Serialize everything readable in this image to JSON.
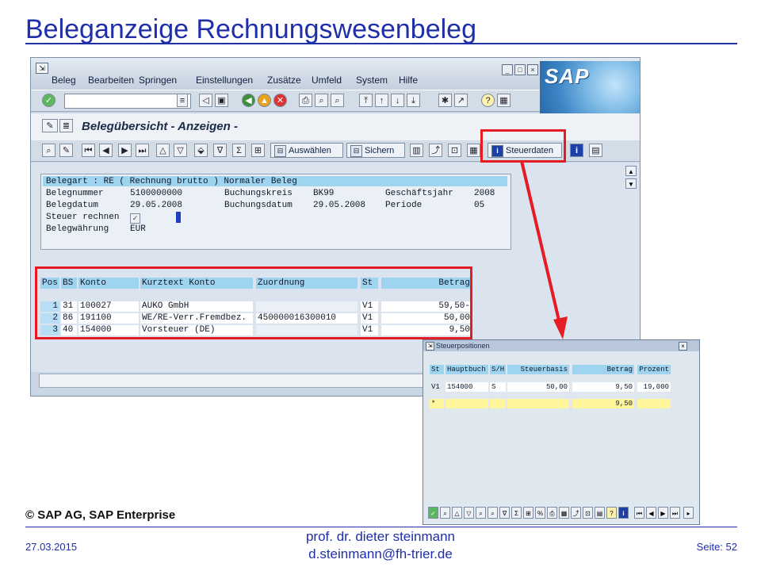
{
  "slide": {
    "title": "Beleganzeige Rechnungswesenbeleg",
    "copyright": "© SAP AG, SAP Enterprise",
    "footer": {
      "date": "27.03.2015",
      "author": "prof. dr. dieter steinmann",
      "email": "d.steinmann@fh-trier.de",
      "page": "Seite: 52"
    }
  },
  "sap": {
    "logo_text": "SAP",
    "menu": [
      "Beleg",
      "Bearbeiten",
      "Springen",
      "Einstellungen",
      "Zusätze",
      "Umfeld",
      "System",
      "Hilfe"
    ],
    "screen_title": "Belegübersicht - Anzeigen -",
    "buttons": {
      "auswaehlen": "Auswählen",
      "sichern": "Sichern",
      "steuerdaten": "Steuerdaten"
    },
    "header": {
      "belegart_line": "Belegart : RE ( Rechnung brutto ) Normaler Beleg",
      "belegnummer_label": "Belegnummer",
      "belegnummer": "5100000000",
      "buchungskreis_label": "Buchungskreis",
      "buchungskreis": "BK99",
      "geschaeftsjahr_label": "Geschäftsjahr",
      "geschaeftsjahr": "2008",
      "belegdatum_label": "Belegdatum",
      "belegdatum": "29.05.2008",
      "buchungsdatum_label": "Buchungsdatum",
      "buchungsdatum": "29.05.2008",
      "periode_label": "Periode",
      "periode": "05",
      "steuer_label": "Steuer rechnen",
      "waehrung_label": "Belegwährung",
      "waehrung": "EUR"
    },
    "positions": {
      "columns": [
        "Pos",
        "BS",
        "Konto",
        "Kurztext Konto",
        "Zuordnung",
        "St",
        "Betrag"
      ],
      "rows": [
        [
          "1",
          "31",
          "100027",
          "AUKO GmbH",
          "",
          "V1",
          "59,50-"
        ],
        [
          "2",
          "86",
          "191100",
          "WE/RE-Verr.Fremdbez.",
          "450000016300010",
          "V1",
          "50,00"
        ],
        [
          "3",
          "40",
          "154000",
          "Vorsteuer (DE)",
          "",
          "V1",
          "9,50"
        ]
      ]
    }
  },
  "popup": {
    "title": "Steuerpositionen",
    "columns": [
      "St",
      "Hauptbuch",
      "S/H",
      "Steuerbasis",
      "Betrag",
      "Prozent"
    ],
    "row": [
      "V1",
      "154000",
      "S",
      "50,00",
      "9,50",
      "19,000"
    ],
    "total_marker": "*",
    "total": "9,50"
  }
}
